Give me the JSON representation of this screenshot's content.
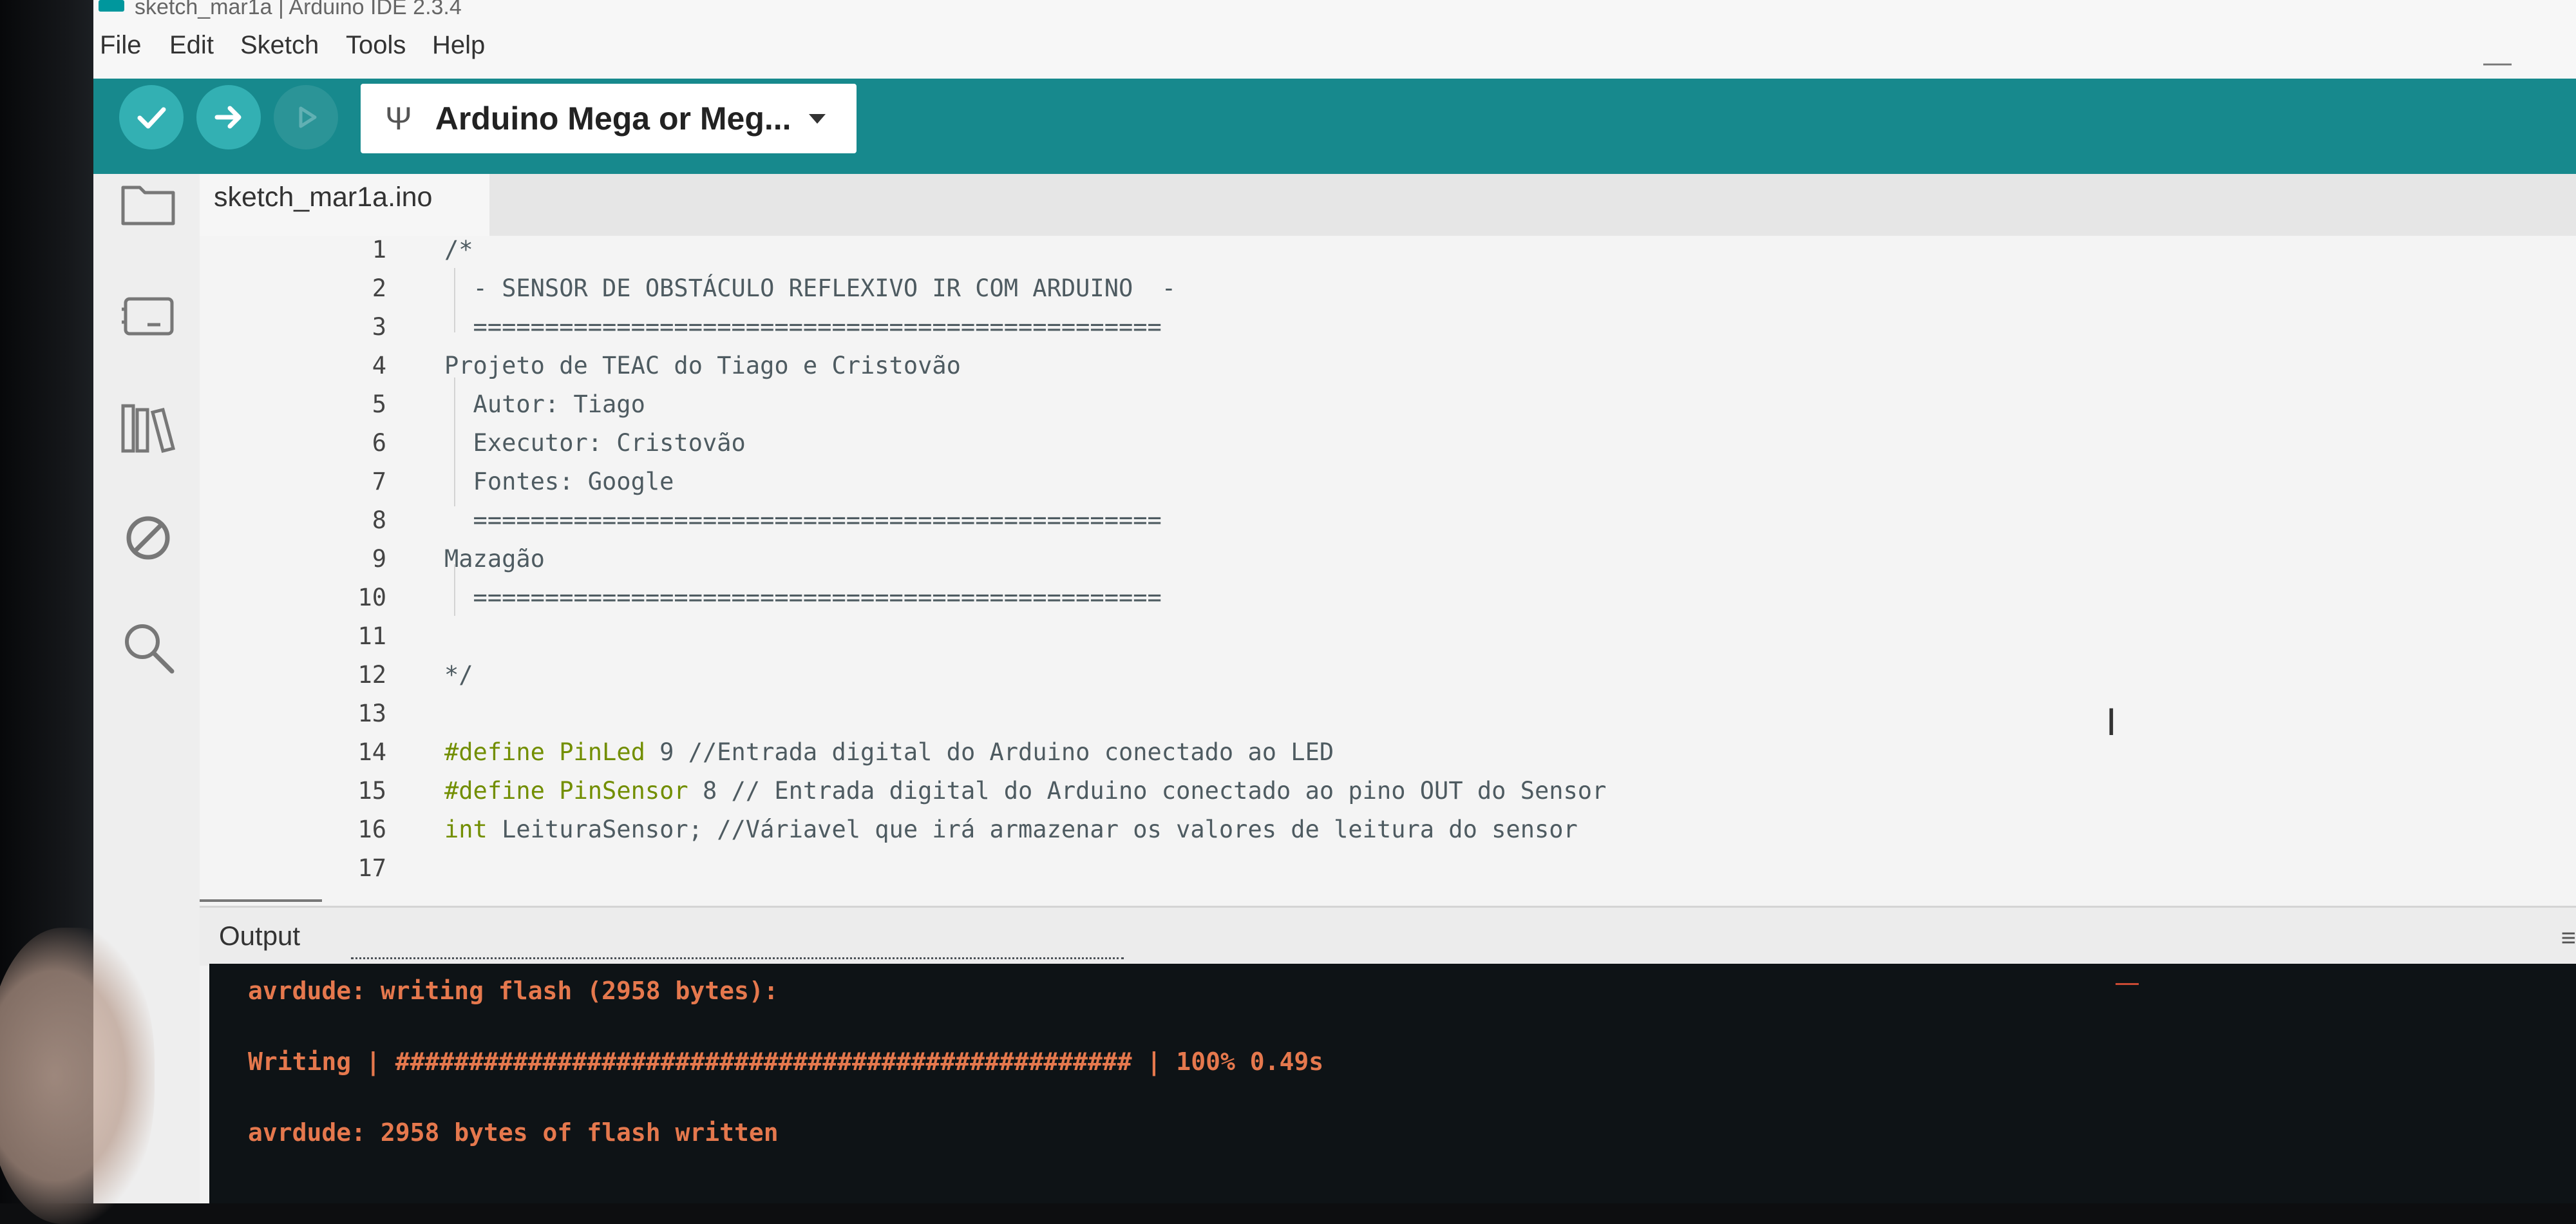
{
  "window": {
    "title": "sketch_mar1a | Arduino IDE 2.3.4"
  },
  "menu": [
    "File",
    "Edit",
    "Sketch",
    "Tools",
    "Help"
  ],
  "toolbar": {
    "board": "Arduino Mega or Meg...",
    "verify_icon": "check-icon",
    "upload_icon": "arrow-right-icon",
    "debug_icon": "debug-icon"
  },
  "sidebar": {
    "icons": [
      "folder-icon",
      "board-icon",
      "library-icon",
      "debug-ban-icon",
      "search-icon"
    ]
  },
  "tab": {
    "label": "sketch_mar1a.ino"
  },
  "code_lines": [
    {
      "n": "1",
      "text": "/*"
    },
    {
      "n": "2",
      "text": "  - SENSOR DE OBSTÁCULO REFLEXIVO IR COM ARDUINO  -"
    },
    {
      "n": "3",
      "text": "  ================================================"
    },
    {
      "n": "4",
      "text": "Projeto de TEAC do Tiago e Cristovão"
    },
    {
      "n": "5",
      "text": "  Autor: Tiago"
    },
    {
      "n": "6",
      "text": "  Executor: Cristovão"
    },
    {
      "n": "7",
      "text": "  Fontes: Google"
    },
    {
      "n": "8",
      "text": "  ================================================"
    },
    {
      "n": "9",
      "text": "Mazagão"
    },
    {
      "n": "10",
      "text": "  ================================================"
    },
    {
      "n": "11",
      "text": ""
    },
    {
      "n": "12",
      "text": "*/"
    },
    {
      "n": "13",
      "text": ""
    },
    {
      "n": "14",
      "kw": "#define",
      "ident": " PinLed",
      "rest": " 9 //Entrada digital do Arduino conectado ao LED"
    },
    {
      "n": "15",
      "kw": "#define",
      "ident": " PinSensor",
      "rest": " 8 // Entrada digital do Arduino conectado ao pino OUT do Sensor"
    },
    {
      "n": "16",
      "kw": "int",
      "ident": "",
      "rest": " LeituraSensor; //Váriavel que irá armazenar os valores de leitura do sensor"
    },
    {
      "n": "17",
      "text": ""
    }
  ],
  "output": {
    "label": "Output",
    "lines": [
      "avrdude: writing flash (2958 bytes):",
      "Writing | ################################################## | 100% 0.49s",
      "avrdude: 2958 bytes of flash written"
    ]
  },
  "colors": {
    "toolbar": "#17898d",
    "keyword": "#728e00",
    "console_text": "#e5784d"
  }
}
